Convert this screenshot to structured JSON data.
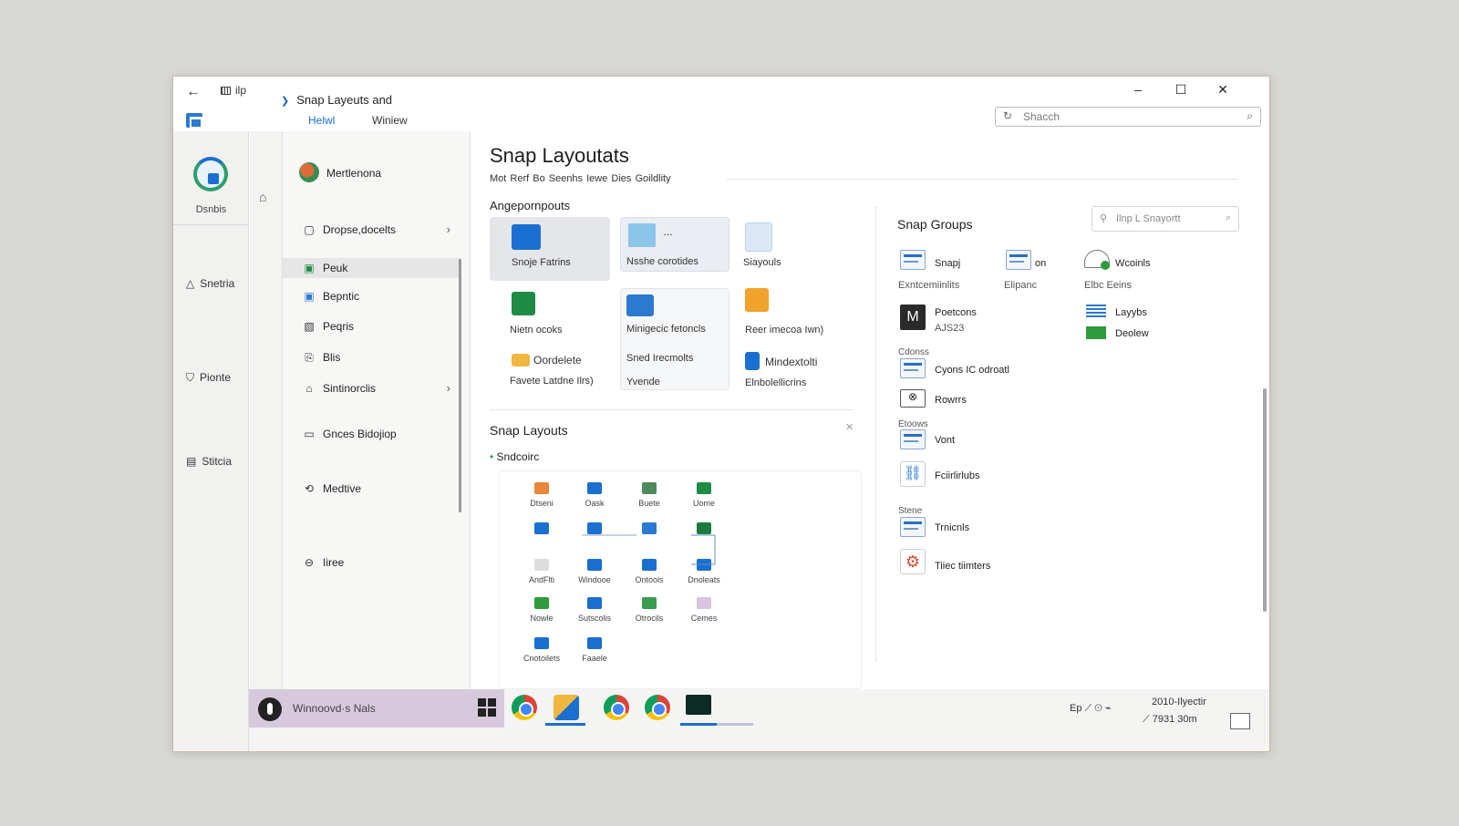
{
  "titlebar": {
    "app_label": "ilp",
    "title": "Snap Layeuts and",
    "tab_active": "Helwl",
    "tab_other": "Winiew",
    "search_placeholder": "Shacch"
  },
  "rail": {
    "label": "Dsnbis",
    "items": [
      {
        "icon": "△",
        "label": "Snetria"
      },
      {
        "icon": "⛉",
        "label": "Pionte"
      },
      {
        "icon": "▤",
        "label": "Stitcia"
      }
    ]
  },
  "nav": {
    "user": "Mertlenona",
    "items": [
      {
        "icon": "▢",
        "label": "Dropse,docelts",
        "chevron": true,
        "selected": false
      },
      {
        "icon": "▣",
        "label": "Peuk",
        "chevron": false,
        "selected": true
      },
      {
        "icon": "▣",
        "label": "Bepntic",
        "chevron": false,
        "selected": false
      },
      {
        "icon": "▧",
        "label": "Peqris",
        "chevron": false,
        "selected": false
      },
      {
        "icon": "⎘",
        "label": "Blis",
        "chevron": false,
        "selected": false
      },
      {
        "icon": "⌂",
        "label": "Sintinorclis",
        "chevron": true,
        "selected": false
      },
      {
        "icon": "▭",
        "label": "Gnces Bidojiop",
        "chevron": false,
        "selected": false
      },
      {
        "icon": "⟲",
        "label": "Medtive",
        "chevron": false,
        "selected": false
      },
      {
        "icon": "⊖",
        "label": "Iiree",
        "chevron": false,
        "selected": false
      }
    ]
  },
  "main": {
    "title": "Snap Layoutats",
    "subtabs": "Mot Rerf Bo  Seenhs  Iewe  Dies  Goildlity",
    "apps_section": "Angepornpouts",
    "apps": [
      {
        "label": "Snoje Fatrins",
        "color": "#1a6fd0"
      },
      {
        "label": "Nsshe corotides",
        "color": "#8cc4ea"
      },
      {
        "label": "Siayouls",
        "color": "#5a8fd8"
      },
      {
        "label": "Nietn ocoks",
        "color": "#1e8c45"
      },
      {
        "label": "Minigecic fetoncls",
        "color": "#2b79d0"
      },
      {
        "label": "Reer imecoa Iwn)",
        "color": "#f0a22a"
      },
      {
        "label": "Oordelete",
        "color": "#f0b640"
      },
      {
        "label": "Favete Latdne Ilrs)",
        "color": "#888888"
      },
      {
        "label": "Sned Irecmolts",
        "color": "#1a6fd0"
      },
      {
        "label": "Yvende",
        "color": "#666666"
      },
      {
        "label": "Mindextolti",
        "color": "#1a6fd0"
      },
      {
        "label": "Elnbolellicrins",
        "color": "#666666"
      }
    ],
    "layouts_section": "Snap Layouts",
    "layouts_sub": "Sndcoirc",
    "grid": [
      {
        "label": "Dtseni",
        "color": "#e9863a"
      },
      {
        "label": "Oask",
        "color": "#1a6fd0"
      },
      {
        "label": "Buete",
        "color": "#4c8a5c"
      },
      {
        "label": "Uome",
        "color": "#1e8c45"
      },
      {
        "label": "",
        "color": "#1a6fd0"
      },
      {
        "label": "",
        "color": "#1a6fd0"
      },
      {
        "label": "",
        "color": "#2b79d0"
      },
      {
        "label": "",
        "color": "#1e7a3c"
      },
      {
        "label": "AndFlti",
        "color": "#dddddd"
      },
      {
        "label": "Windooe",
        "color": "#1a6fd0"
      },
      {
        "label": "Ontools",
        "color": "#1a6fd0"
      },
      {
        "label": "Dnoleats",
        "color": "#1a6fd0"
      },
      {
        "label": "Nowle",
        "color": "#2e9c3c"
      },
      {
        "label": "Sutscolis",
        "color": "#1a6fd0"
      },
      {
        "label": "Otrocils",
        "color": "#3a9c4c"
      },
      {
        "label": "Cemes",
        "color": "#d8c3e0"
      },
      {
        "label": "Cnotoilets",
        "color": "#1a6fd0"
      },
      {
        "label": "Faaele",
        "color": "#1a6fd0"
      }
    ],
    "groups_section": "Snap Groups",
    "groups_search": "Ilnp L Snayortt",
    "groups": [
      {
        "title": "Snapj",
        "sub": "Exntcemiinlits"
      },
      {
        "title": "on",
        "sub": "Elipanc"
      },
      {
        "title": "Wcoinls",
        "sub": "Elbc Eeins"
      },
      {
        "title": "Poetcons",
        "sub": "AJS23"
      },
      {
        "title": "Layybs",
        "sub": ""
      },
      {
        "title": "Deolew",
        "sub": ""
      },
      {
        "title": "Cyons IC odroatl",
        "caption": "Cdonss"
      },
      {
        "title": "Rowrrs",
        "caption": ""
      },
      {
        "title": "Vont",
        "caption": "Etoows"
      },
      {
        "title": "Fciirlirlubs",
        "caption": ""
      },
      {
        "title": "Trnicnls",
        "caption": "Stene"
      },
      {
        "title": "Tiiec tiimters",
        "caption": ""
      }
    ]
  },
  "taskbar": {
    "pinned_label": "Winnoovd·s Nals",
    "tray_icons": "Ep  ⟋  ⊙  ⌁",
    "tray_line1": "2010-Ilyectir",
    "tray_line2": "7931 30m"
  }
}
